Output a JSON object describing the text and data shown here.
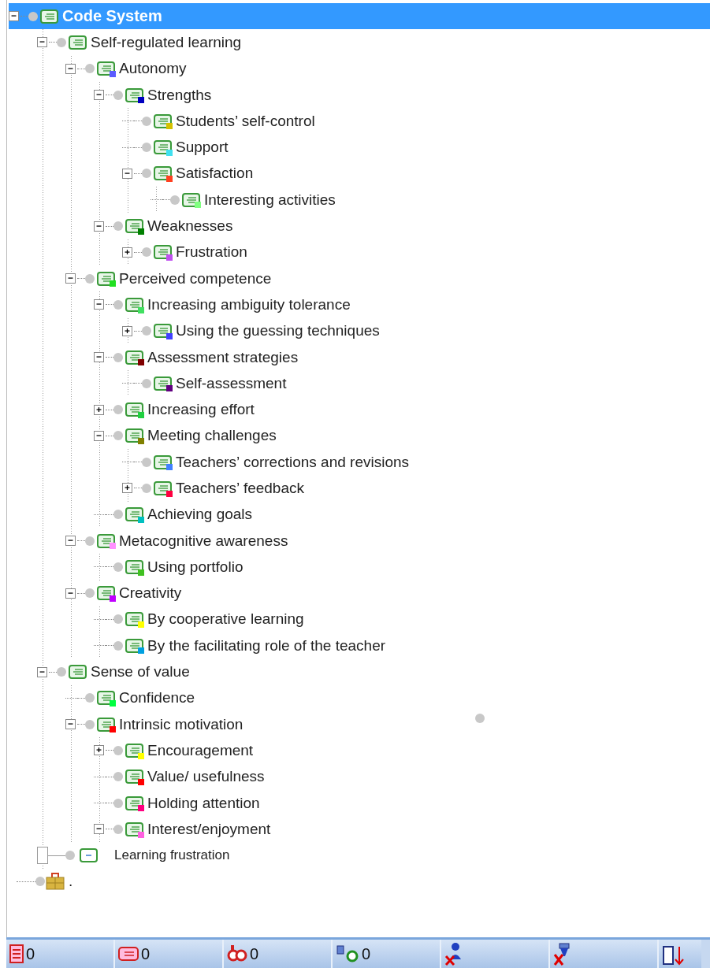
{
  "tree": [
    {
      "label": "Code System",
      "kind": "branch",
      "selected": true,
      "children": [
        {
          "label": "Self-regulated learning",
          "kind": "branch",
          "selected": false,
          "children": [
            {
              "label": "Autonomy",
              "kind": "branch",
              "selected": false,
              "color": "#5b5bff",
              "children": [
                {
                  "label": "Strengths",
                  "kind": "branch",
                  "selected": false,
                  "color": "#0000c0",
                  "children": [
                    {
                      "label": "Students’ self-control",
                      "kind": "leaf",
                      "selected": false,
                      "color": "#d4c000"
                    },
                    {
                      "label": "Support",
                      "kind": "leaf",
                      "selected": false,
                      "color": "#40e0f0"
                    },
                    {
                      "label": "Satisfaction",
                      "kind": "branch",
                      "selected": false,
                      "color": "#ff4020",
                      "children": [
                        {
                          "label": "Interesting activities",
                          "kind": "leaf",
                          "selected": false,
                          "color": "#80ff80"
                        }
                      ]
                    }
                  ]
                },
                {
                  "label": "Weaknesses",
                  "kind": "branch",
                  "selected": false,
                  "color": "#008000",
                  "children": [
                    {
                      "label": "Frustration",
                      "kind": "collapsed",
                      "selected": false,
                      "color": "#c050f0"
                    }
                  ]
                }
              ]
            },
            {
              "label": "Perceived competence",
              "kind": "branch",
              "selected": false,
              "color": "#20e020",
              "children": [
                {
                  "label": "Increasing ambiguity tolerance",
                  "kind": "branch",
                  "selected": false,
                  "color": "#40e060",
                  "children": [
                    {
                      "label": "Using the guessing techniques",
                      "kind": "collapsed",
                      "selected": false,
                      "color": "#4040ff"
                    }
                  ]
                },
                {
                  "label": "Assessment strategies",
                  "kind": "branch",
                  "selected": false,
                  "color": "#800000",
                  "children": [
                    {
                      "label": "Self-assessment",
                      "kind": "leaf",
                      "selected": false,
                      "color": "#600080"
                    }
                  ]
                },
                {
                  "label": "Increasing effort",
                  "kind": "collapsed",
                  "selected": false,
                  "color": "#20d040"
                },
                {
                  "label": "Meeting challenges",
                  "kind": "branch",
                  "selected": false,
                  "color": "#808000",
                  "children": [
                    {
                      "label": "Teachers’ corrections and revisions",
                      "kind": "leaf",
                      "selected": false,
                      "color": "#4080ff"
                    },
                    {
                      "label": "Teachers’ feedback",
                      "kind": "collapsed",
                      "selected": false,
                      "color": "#ff0040"
                    }
                  ]
                },
                {
                  "label": "Achieving goals",
                  "kind": "leaf",
                  "selected": false,
                  "color": "#00c0c0"
                }
              ]
            },
            {
              "label": "Metacognitive awareness",
              "kind": "branch",
              "selected": false,
              "color": "#ff90ff",
              "children": [
                {
                  "label": "Using portfolio",
                  "kind": "leaf",
                  "selected": false,
                  "color": "#40c020"
                }
              ]
            },
            {
              "label": "Creativity",
              "kind": "branch",
              "selected": false,
              "color": "#c000ff",
              "children": [
                {
                  "label": "By cooperative learning",
                  "kind": "leaf",
                  "selected": false,
                  "color": "#ffff00"
                },
                {
                  "label": "By the facilitating role of the teacher",
                  "kind": "leaf",
                  "selected": false,
                  "color": "#00a0e0"
                }
              ]
            }
          ]
        },
        {
          "label": "Sense of value",
          "kind": "branch",
          "selected": false,
          "children": [
            {
              "label": "Confidence",
              "kind": "leaf",
              "selected": false,
              "color": "#00ff40"
            },
            {
              "label": "Intrinsic motivation",
              "kind": "branch",
              "selected": false,
              "color": "#ff0000",
              "children": [
                {
                  "label": "Encouragement",
                  "kind": "collapsed",
                  "selected": false,
                  "color": "#ffff00"
                },
                {
                  "label": "Value/ usefulness",
                  "kind": "leaf",
                  "selected": false,
                  "color": "#ff0000"
                },
                {
                  "label": "Holding attention",
                  "kind": "leaf",
                  "selected": false,
                  "color": "#ff0080"
                },
                {
                  "label": "Interest/enjoyment",
                  "kind": "branch",
                  "selected": false,
                  "color": "#ff60e0"
                }
              ]
            }
          ]
        },
        {
          "label": "Learning frustration",
          "kind": "editing",
          "selected": false
        }
      ]
    },
    {
      "label": ".",
      "kind": "sets",
      "selected": false
    }
  ],
  "status_bar": [
    {
      "kind": "documents",
      "count": "0"
    },
    {
      "kind": "codes",
      "count": "0"
    },
    {
      "kind": "memos",
      "count": "0"
    },
    {
      "kind": "variables",
      "count": "0"
    },
    {
      "kind": "user"
    },
    {
      "kind": "filter"
    },
    {
      "kind": "export"
    }
  ]
}
